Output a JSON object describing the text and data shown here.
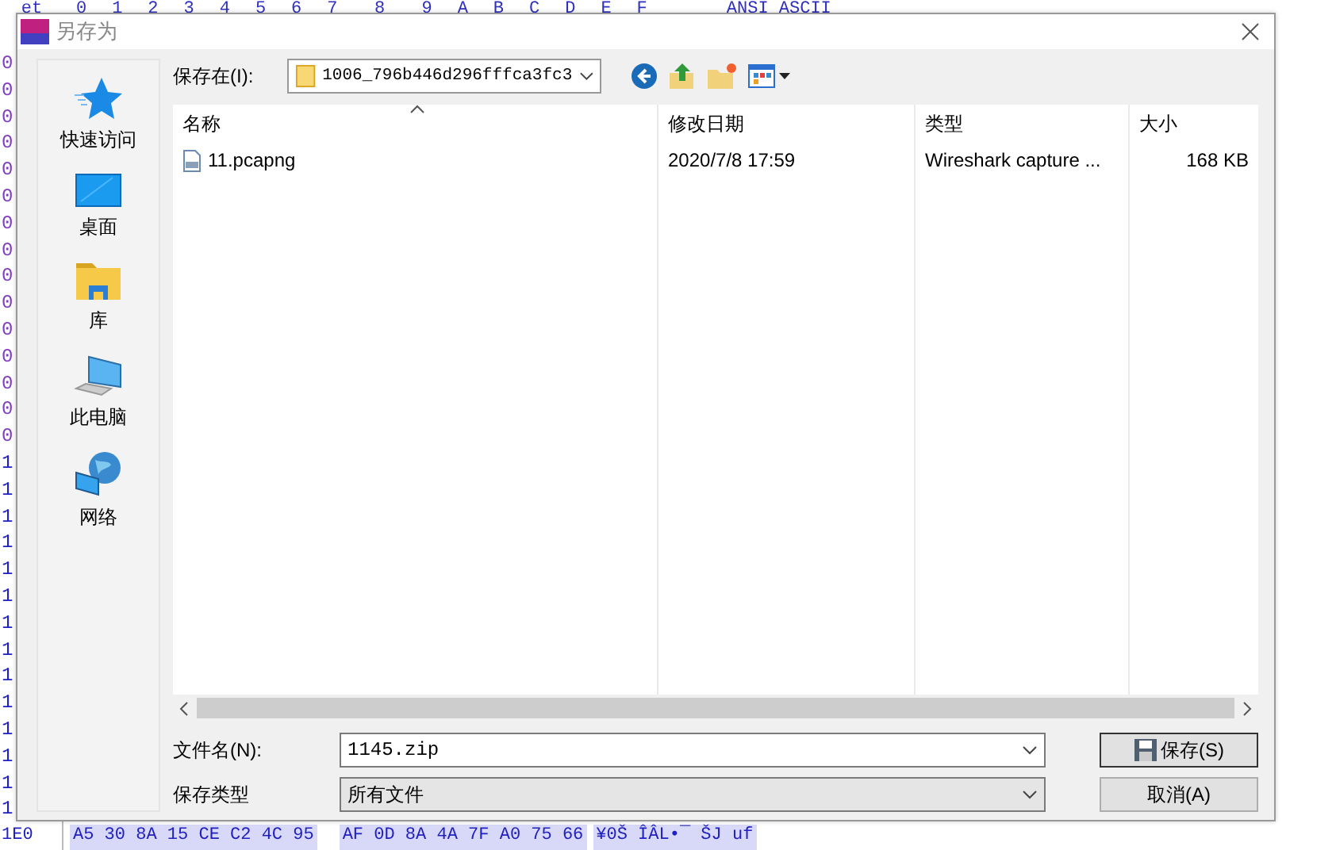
{
  "hex_editor": {
    "header": {
      "offset_label": "et",
      "columns": [
        "0",
        "1",
        "2",
        "3",
        "4",
        "5",
        "6",
        "7",
        "8",
        "9",
        "A",
        "B",
        "C",
        "D",
        "E",
        "F"
      ],
      "text_label": "ANSI ASCII"
    },
    "offsets": [
      "0",
      "0",
      "0",
      "0",
      "0",
      "0",
      "0",
      "0",
      "0",
      "0",
      "0",
      "0",
      "0",
      "0",
      "0",
      "1",
      "1",
      "1",
      "1",
      "1",
      "1",
      "1",
      "1",
      "1",
      "1",
      "1",
      "1",
      "1",
      "1"
    ],
    "last_row": {
      "offset": "1E0",
      "bytes": [
        "A5 30 8A 15 CE C2 4C 95",
        "AF 0D 8A 4A 7F A0 75 66"
      ],
      "text": "¥0Š ÎÂL•¯ ŠJ  uf"
    }
  },
  "window": {
    "title": "另存为"
  },
  "sidebar": {
    "items": [
      {
        "label": "快速访问",
        "kind": "star"
      },
      {
        "label": "桌面",
        "kind": "desktop"
      },
      {
        "label": "库",
        "kind": "library"
      },
      {
        "label": "此电脑",
        "kind": "computer"
      },
      {
        "label": "网络",
        "kind": "network"
      }
    ]
  },
  "location": {
    "label": "保存在(I):",
    "folder": "1006_796b446d296fffca3fc3"
  },
  "file_list": {
    "columns": [
      {
        "label": "名称",
        "sorted": true
      },
      {
        "label": "修改日期",
        "sorted": false
      },
      {
        "label": "类型",
        "sorted": false
      },
      {
        "label": "大小",
        "sorted": false
      }
    ],
    "rows": [
      {
        "cells": [
          "11.pcapng",
          "2020/7/8 17:59",
          "Wireshark capture ...",
          "168 KB"
        ]
      }
    ]
  },
  "file_name": {
    "label": "文件名(N):",
    "value": "1145.zip"
  },
  "file_type": {
    "label": "保存类型",
    "value": "所有文件"
  },
  "buttons": [
    {
      "label": "保存(S)",
      "kind": "save"
    },
    {
      "label": "取消(A)",
      "kind": "cancel"
    }
  ]
}
